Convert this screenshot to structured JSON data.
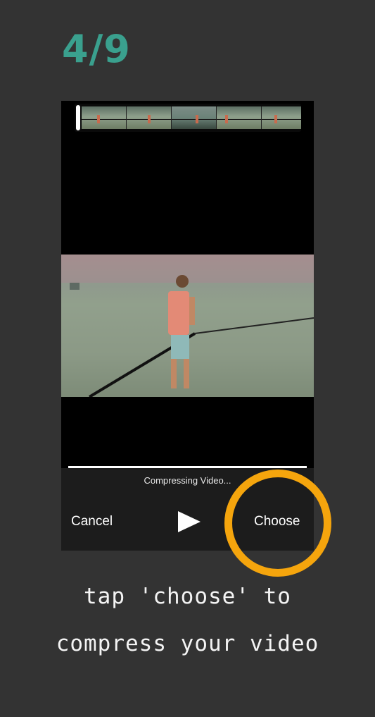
{
  "step_counter": "4/9",
  "trim_bar": {
    "frame_count": 5,
    "scrub_handle": "white-handle"
  },
  "status_text": "Compressing Video...",
  "controls": {
    "cancel_label": "Cancel",
    "play_icon": "play-icon",
    "choose_label": "Choose"
  },
  "highlight": {
    "color": "#f5a50d",
    "target": "Choose"
  },
  "caption": {
    "line1": "tap 'choose' to",
    "line2": "compress your video"
  },
  "colors": {
    "background": "#333333",
    "accent": "#3aa08e",
    "highlight_ring": "#f5a50d"
  }
}
